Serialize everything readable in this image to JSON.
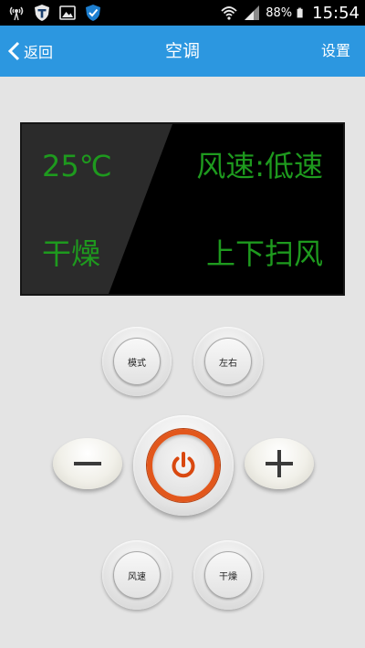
{
  "status_bar": {
    "battery_percent": "88%",
    "time": "15:54"
  },
  "app_bar": {
    "back_label": "返回",
    "title": "空调",
    "settings_label": "设置"
  },
  "display": {
    "temperature": "25℃",
    "fan_speed": "风速:低速",
    "mode": "干燥",
    "swing": "上下扫风"
  },
  "buttons": {
    "mode": "模式",
    "left_right": "左右",
    "fan_speed": "风速",
    "dry": "干燥",
    "minus_icon": "minus-icon",
    "plus_icon": "plus-icon",
    "power_icon": "power-icon"
  },
  "colors": {
    "app_bar": "#2c97e0",
    "lcd_text": "#1e9a1e",
    "power_ring": "#e2571c"
  }
}
